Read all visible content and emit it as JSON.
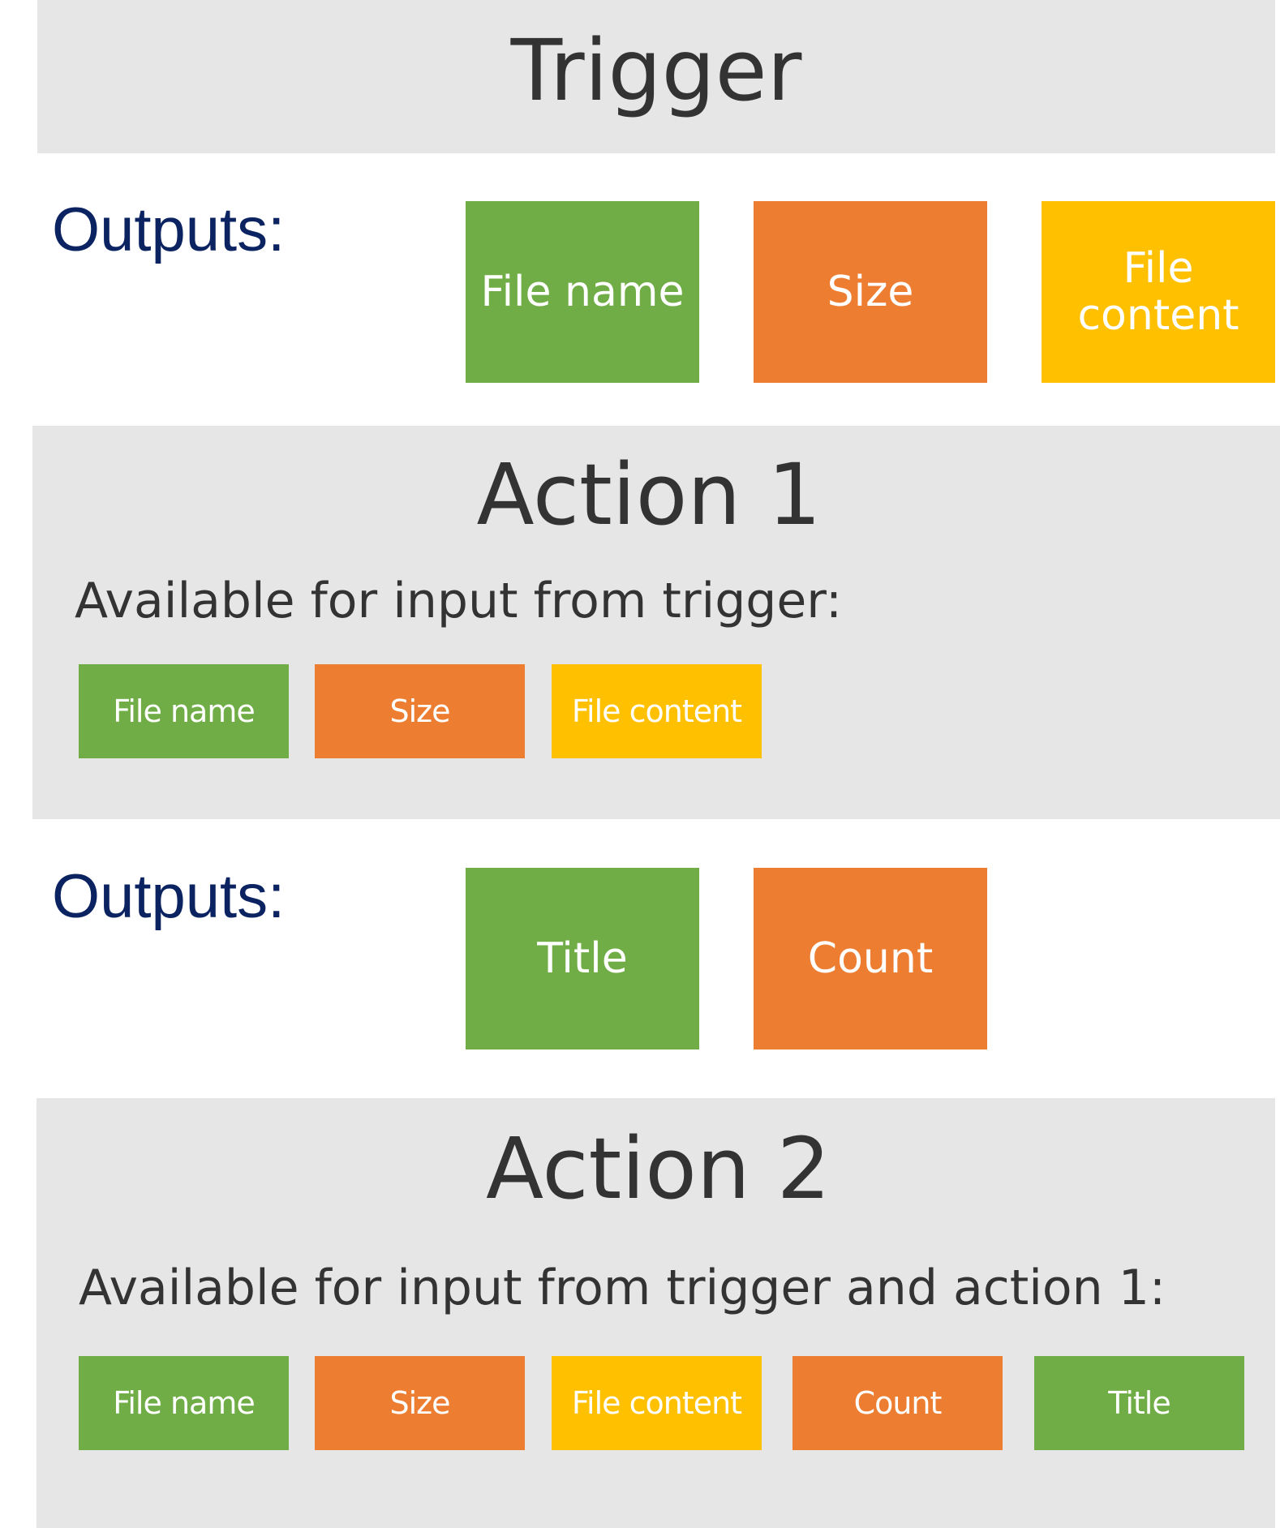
{
  "colors": {
    "band": "#e6e6e6",
    "title_text": "#333333",
    "outputs_label": "#0b2461",
    "green": "#70ad47",
    "orange": "#ed7d31",
    "yellow": "#ffc000"
  },
  "trigger": {
    "title": "Trigger",
    "outputs_label": "Outputs:",
    "outputs": [
      {
        "label": "File name",
        "color": "green"
      },
      {
        "label": "Size",
        "color": "orange"
      },
      {
        "label": "File content",
        "color": "yellow"
      }
    ]
  },
  "action1": {
    "title": "Action 1",
    "available_label": "Available for input from trigger:",
    "inputs": [
      {
        "label": "File name",
        "color": "green"
      },
      {
        "label": "Size",
        "color": "orange"
      },
      {
        "label": "File content",
        "color": "yellow"
      }
    ],
    "outputs_label": "Outputs:",
    "outputs": [
      {
        "label": "Title",
        "color": "green"
      },
      {
        "label": "Count",
        "color": "orange"
      }
    ]
  },
  "action2": {
    "title": "Action 2",
    "available_label": "Available for input from trigger and action 1:",
    "inputs": [
      {
        "label": "File name",
        "color": "green"
      },
      {
        "label": "Size",
        "color": "orange"
      },
      {
        "label": "File content",
        "color": "yellow"
      },
      {
        "label": "Count",
        "color": "orange"
      },
      {
        "label": "Title",
        "color": "green"
      }
    ]
  }
}
